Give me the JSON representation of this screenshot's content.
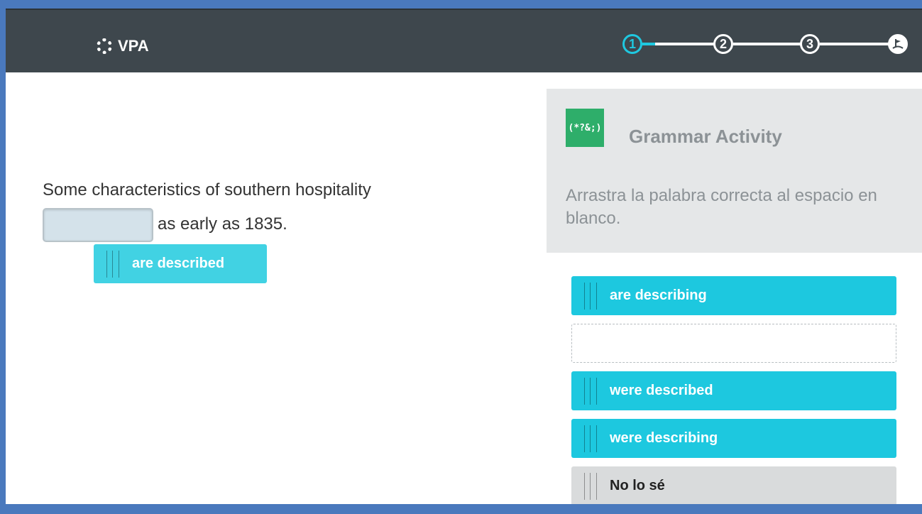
{
  "app": {
    "brand": "VPA"
  },
  "stepper": {
    "steps": [
      "1",
      "2",
      "3"
    ],
    "current_step": 1
  },
  "question": {
    "text_before": "Some characteristics of southern hospitality",
    "text_after": "as early as 1835.",
    "dragged_answer": "are described"
  },
  "panel": {
    "icon_text": "(*?&;)",
    "title": "Grammar Activity",
    "instructions": "Arrastra la palabra correcta al espacio en blanco."
  },
  "options": [
    {
      "label": "are describing"
    },
    {
      "label": ""
    },
    {
      "label": "were described"
    },
    {
      "label": "were describing"
    },
    {
      "label": "No lo sé"
    }
  ],
  "colors": {
    "header_bg": "#3e474d",
    "accent": "#1dc8df",
    "grammar_icon": "#2eae6a",
    "frame": "#4a79bd"
  }
}
